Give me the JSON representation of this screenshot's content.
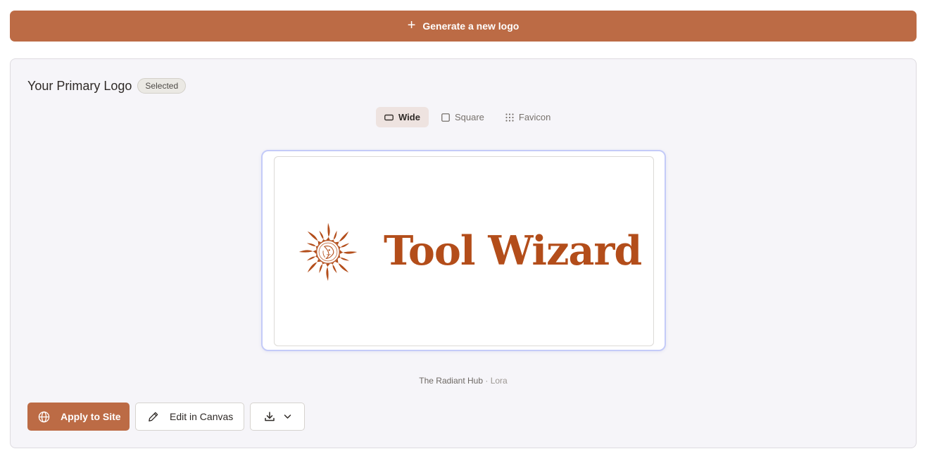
{
  "generate_button": {
    "label": "Generate a new logo"
  },
  "panel": {
    "title": "Your Primary Logo",
    "badge": "Selected",
    "tabs": [
      {
        "label": "Wide",
        "icon": "wide-rectangle-icon",
        "active": true
      },
      {
        "label": "Square",
        "icon": "square-icon",
        "active": false
      },
      {
        "label": "Favicon",
        "icon": "grid-dots-icon",
        "active": false
      }
    ],
    "preview": {
      "brand_name": "Tool Wizard",
      "emblem": "sun-face-icon"
    },
    "caption": {
      "site_name": "The Radiant Hub",
      "separator": " · ",
      "font_name": "Lora"
    },
    "actions": {
      "apply_label": "Apply to Site",
      "edit_label": "Edit in Canvas"
    }
  },
  "colors": {
    "accent": "#bc6b45",
    "brand_text": "#b34d1a",
    "frame_border": "#c4cbf8"
  }
}
